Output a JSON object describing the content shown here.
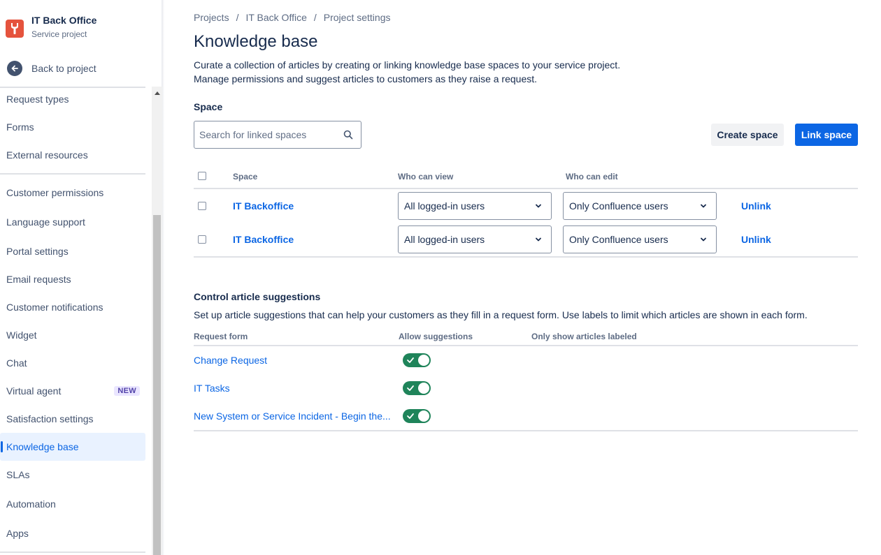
{
  "project": {
    "name": "IT Back Office",
    "type": "Service project"
  },
  "sidebar": {
    "back_label": "Back to project",
    "items": [
      {
        "label": "Request types"
      },
      {
        "label": "Forms"
      },
      {
        "label": "External resources"
      },
      {
        "label": "Customer permissions"
      },
      {
        "label": "Language support"
      },
      {
        "label": "Portal settings"
      },
      {
        "label": "Email requests"
      },
      {
        "label": "Customer notifications"
      },
      {
        "label": "Widget"
      },
      {
        "label": "Chat"
      },
      {
        "label": "Virtual agent",
        "badge": "NEW"
      },
      {
        "label": "Satisfaction settings"
      },
      {
        "label": "Knowledge base",
        "active": true
      },
      {
        "label": "SLAs"
      },
      {
        "label": "Automation"
      },
      {
        "label": "Apps"
      }
    ]
  },
  "breadcrumb": [
    "Projects",
    "IT Back Office",
    "Project settings"
  ],
  "breadcrumb_sep": "/",
  "page": {
    "title": "Knowledge base",
    "desc_line1": "Curate a collection of articles by creating or linking knowledge base spaces to your service project.",
    "desc_line2": "Manage permissions and suggest articles to customers as they raise a request."
  },
  "spaces": {
    "section_label": "Space",
    "search_placeholder": "Search for linked spaces",
    "create_button": "Create space",
    "link_button": "Link space",
    "headers": {
      "space": "Space",
      "who_can_view": "Who can view",
      "who_can_edit": "Who can edit"
    },
    "rows": [
      {
        "name": "IT Backoffice",
        "view": "All logged-in users",
        "edit": "Only Confluence users",
        "action": "Unlink"
      },
      {
        "name": "IT Backoffice",
        "view": "All logged-in users",
        "edit": "Only Confluence users",
        "action": "Unlink"
      }
    ]
  },
  "suggestions": {
    "title": "Control article suggestions",
    "desc": "Set up article suggestions that can help your customers as they fill in a request form. Use labels to limit which articles are shown in each form.",
    "headers": {
      "request_form": "Request form",
      "allow": "Allow suggestions",
      "labeled": "Only show articles labeled"
    },
    "rows": [
      {
        "form": "Change Request",
        "allowed": true
      },
      {
        "form": "IT Tasks",
        "allowed": true
      },
      {
        "form": "New System or Service Incident - Begin the...",
        "allowed": true
      }
    ]
  },
  "colors": {
    "accent": "#0c66e4",
    "toggle_on": "#1f845a",
    "project_avatar": "#e5533d"
  }
}
